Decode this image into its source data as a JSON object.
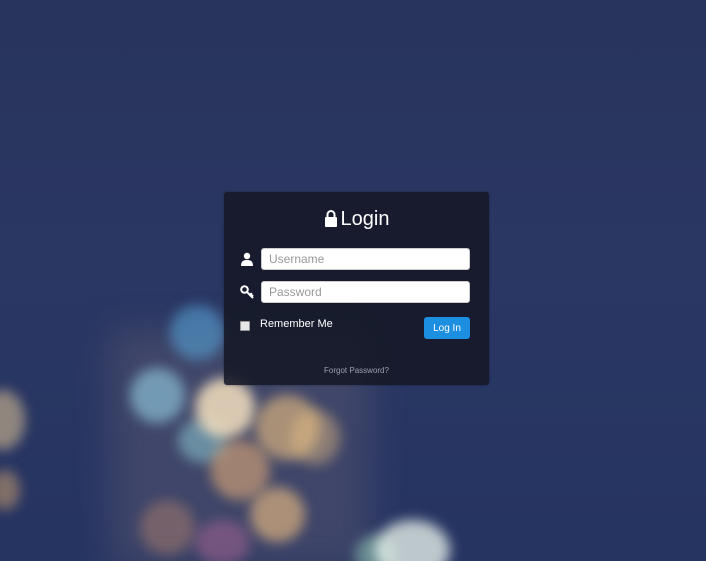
{
  "login": {
    "title": "Login",
    "username": {
      "value": "",
      "placeholder": "Username"
    },
    "password": {
      "value": "",
      "placeholder": "Password"
    },
    "remember_label": "Remember Me",
    "remember_checked": false,
    "submit_label": "Log In",
    "forgot_label": "Forgot Password?"
  },
  "icons": {
    "title": "lock-icon",
    "username": "user-icon",
    "password": "key-icon"
  },
  "colors": {
    "background": "#28345c",
    "panel": "#141826",
    "accent": "#1d8fe0",
    "muted_text": "#9aa0ac"
  }
}
